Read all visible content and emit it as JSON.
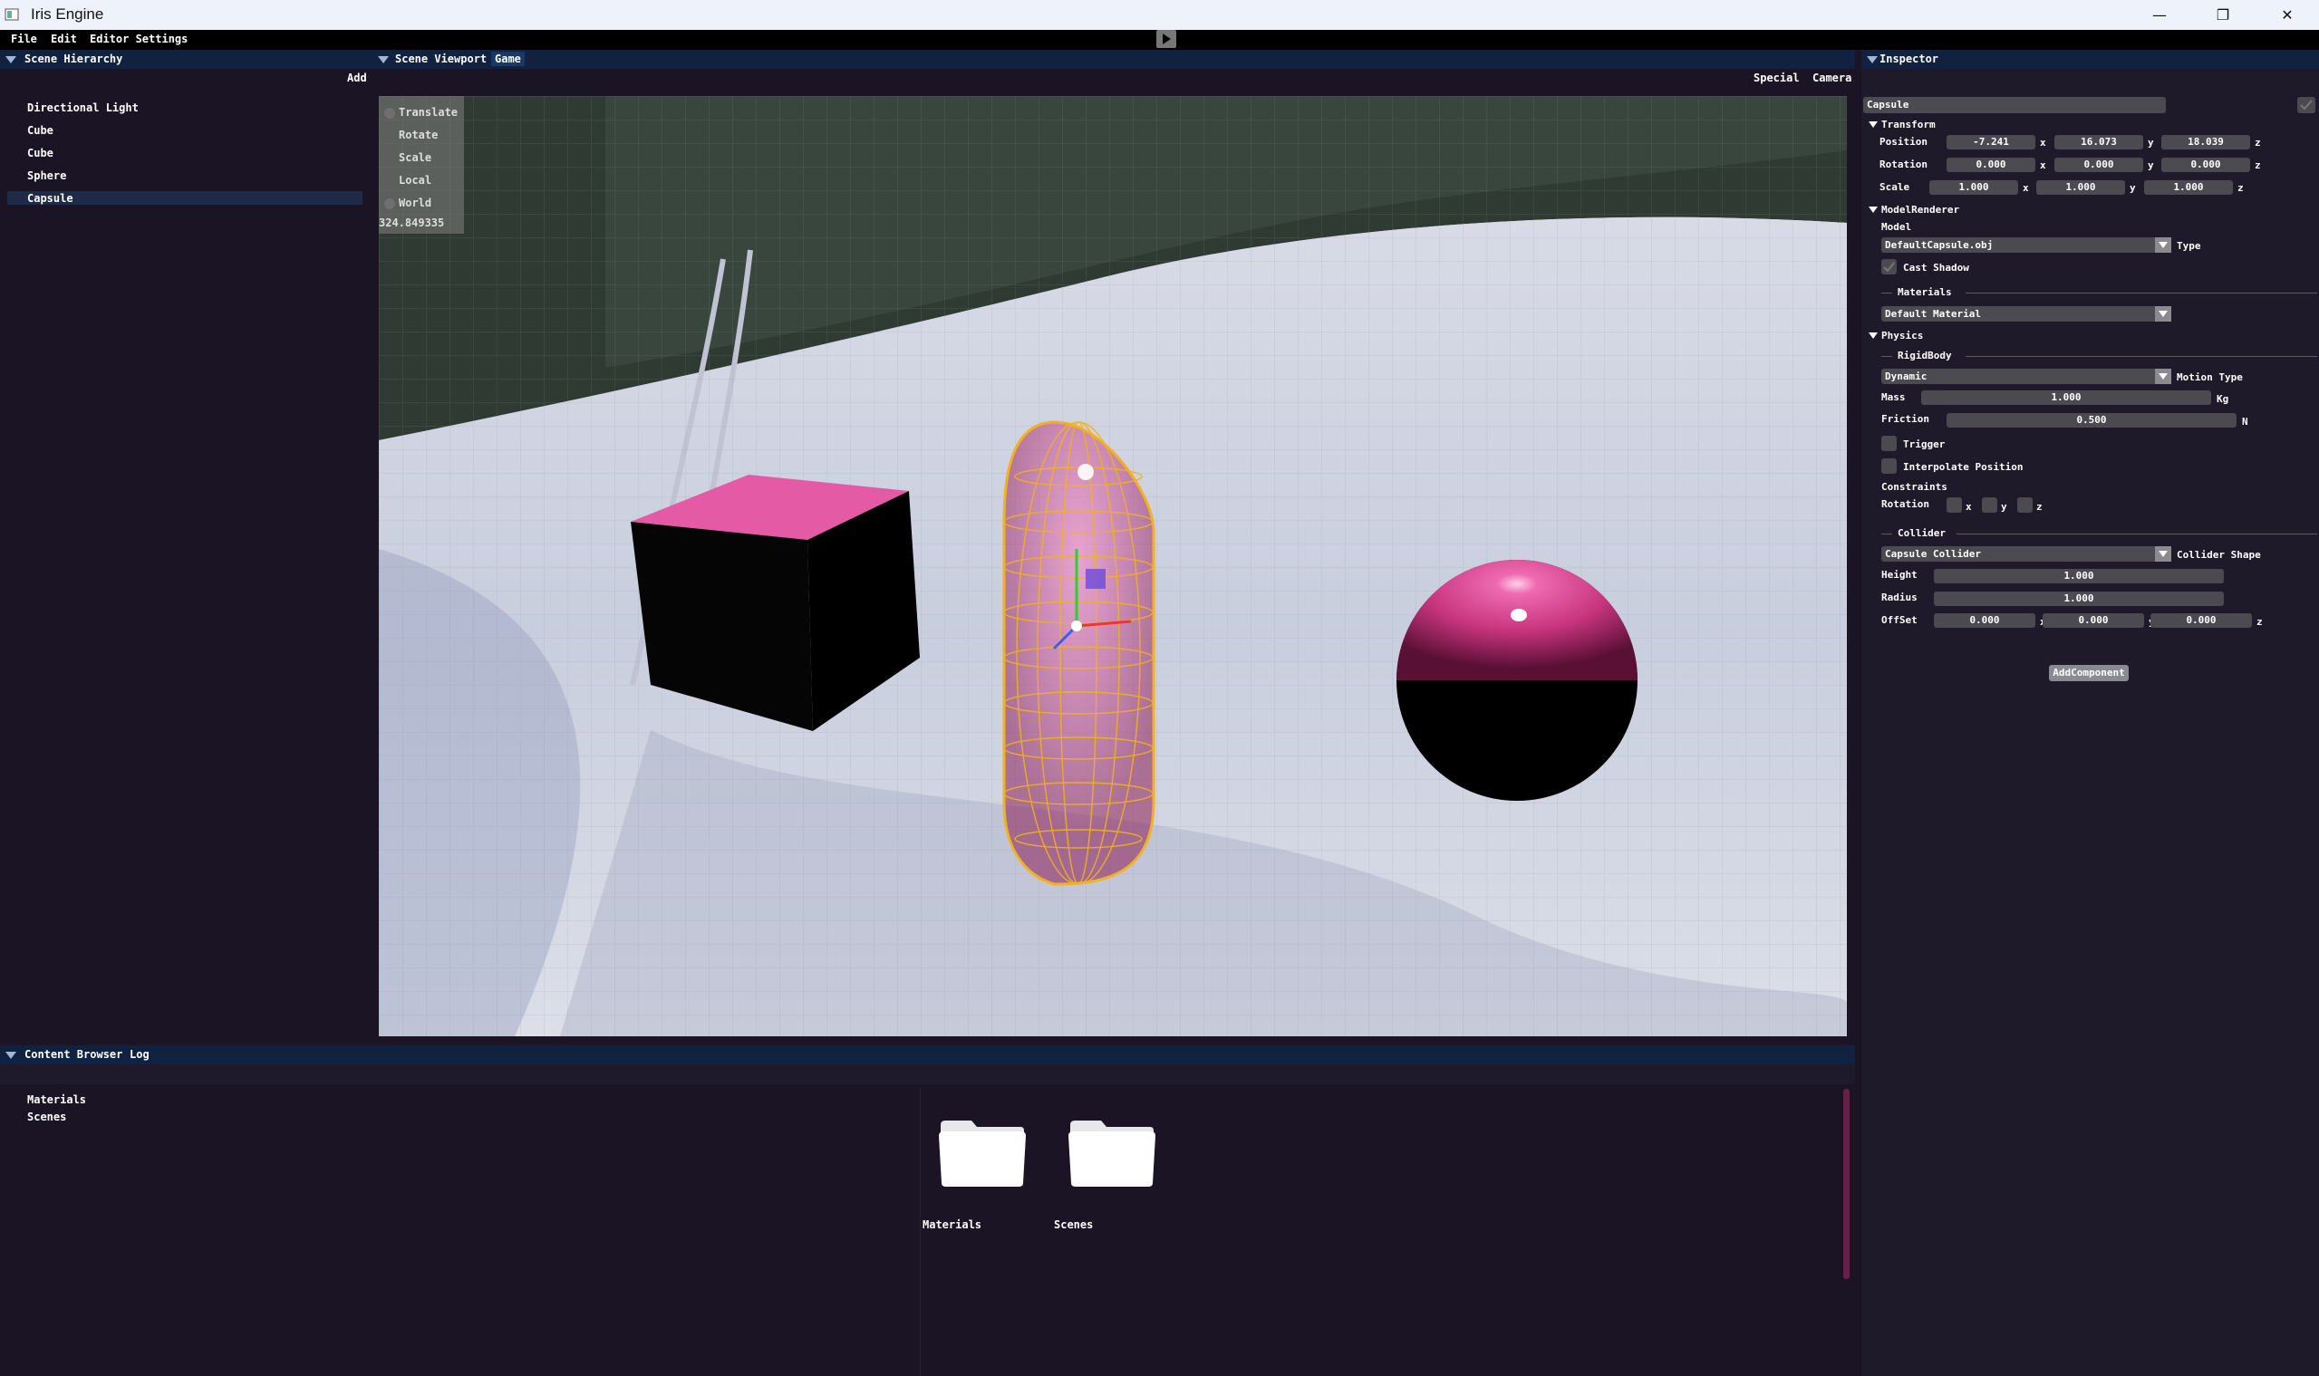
{
  "window": {
    "title": "Iris Engine",
    "minimize": "—",
    "maximize": "❐",
    "close": "✕"
  },
  "menu": {
    "file": "File",
    "edit": "Edit",
    "editor_settings": "Editor Settings"
  },
  "hierarchy": {
    "title": "Scene Hierarchy",
    "add": "Add",
    "items": [
      "Directional Light",
      "Cube",
      "Cube",
      "Sphere",
      "Capsule"
    ],
    "selected_index": 4
  },
  "viewport": {
    "tab_scene": "Scene Viewport",
    "tab_game": "Game",
    "special": "Special",
    "camera": "Camera",
    "gizmo": {
      "translate": "Translate",
      "rotate": "Rotate",
      "scale": "Scale",
      "local": "Local",
      "world": "World",
      "readout": "324.849335"
    }
  },
  "inspector": {
    "title": "Inspector",
    "object_name": "Capsule",
    "transform": {
      "title": "Transform",
      "position_label": "Position",
      "rotation_label": "Rotation",
      "scale_label": "Scale",
      "position": [
        "-7.241",
        "16.073",
        "18.039"
      ],
      "rotation": [
        "0.000",
        "0.000",
        "0.000"
      ],
      "scale": [
        "1.000",
        "1.000",
        "1.000"
      ],
      "x": "x",
      "y": "y",
      "z": "z"
    },
    "model_renderer": {
      "title": "ModelRenderer",
      "model_label": "Model",
      "model_value": "DefaultCapsule.obj",
      "type_label": "Type",
      "cast_shadow": "Cast Shadow",
      "materials": "Materials",
      "material_value": "Default Material"
    },
    "physics": {
      "title": "Physics",
      "rigidbody": "RigidBody",
      "motion_value": "Dynamic",
      "motion_label": "Motion Type",
      "mass_label": "Mass",
      "mass_value": "1.000",
      "mass_unit": "Kg",
      "friction_label": "Friction",
      "friction_value": "0.500",
      "friction_unit": "N",
      "trigger": "Trigger",
      "interpolate": "Interpolate Position",
      "constraints": "Constraints",
      "rotation_label": "Rotation",
      "x": "x",
      "y": "y",
      "z": "z"
    },
    "collider": {
      "title": "Collider",
      "shape_value": "Capsule Collider",
      "shape_label": "Collider Shape",
      "height_label": "Height",
      "height_value": "1.000",
      "radius_label": "Radius",
      "radius_value": "1.000",
      "offset_label": "OffSet",
      "offset": [
        "0.000",
        "0.000",
        "0.000"
      ]
    },
    "add_component": "AddComponent"
  },
  "content_browser": {
    "tab_content": "Content Browser",
    "tab_log": "Log",
    "tree": [
      "Materials",
      "Scenes"
    ],
    "folders": [
      "Materials",
      "Scenes"
    ]
  },
  "colors": {
    "panel_bg": "#1b1424",
    "header_bg": "#10223f",
    "capsule_wire": "#f0b020",
    "pink": "#e8589c"
  }
}
